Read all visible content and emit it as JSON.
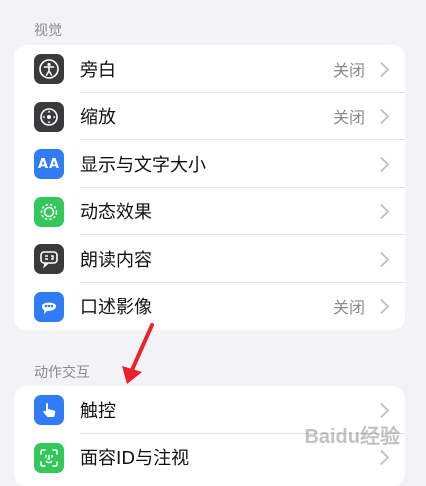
{
  "sections": [
    {
      "header": "视觉",
      "items": [
        {
          "label": "旁白",
          "value": "关闭",
          "icon": "voiceover-icon",
          "color": "#3a3a3c"
        },
        {
          "label": "缩放",
          "value": "关闭",
          "icon": "zoom-icon",
          "color": "#3a3a3c"
        },
        {
          "label": "显示与文字大小",
          "value": "",
          "icon": "text-size-icon",
          "color": "#2f7cf6"
        },
        {
          "label": "动态效果",
          "value": "",
          "icon": "motion-icon",
          "color": "#34c759"
        },
        {
          "label": "朗读内容",
          "value": "",
          "icon": "spoken-content-icon",
          "color": "#3a3a3c"
        },
        {
          "label": "口述影像",
          "value": "关闭",
          "icon": "audio-description-icon",
          "color": "#2f7cf6"
        }
      ]
    },
    {
      "header": "动作交互",
      "items": [
        {
          "label": "触控",
          "value": "",
          "icon": "touch-icon",
          "color": "#2f7cf6"
        },
        {
          "label": "面容ID与注视",
          "value": "",
          "icon": "face-id-icon",
          "color": "#34c759"
        }
      ]
    }
  ],
  "icon_glyphs": {
    "text_size": "AA"
  },
  "watermark": "Baidu经验"
}
